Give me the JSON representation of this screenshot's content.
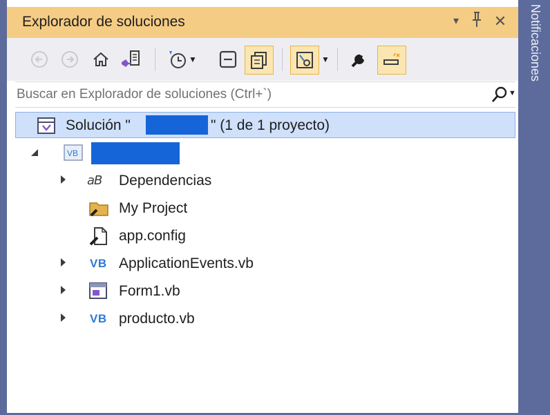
{
  "window": {
    "title": "Explorador de soluciones",
    "title_buttons": [
      "▾",
      "ᵢ",
      "✕"
    ]
  },
  "toolbar": {
    "items": [
      "back-icon",
      "forward-icon",
      "home-icon",
      "switch-views-icon",
      "pending-changes-filter-icon",
      "collapse-all-icon",
      "show-all-files-icon",
      "preview-selected-icon",
      "properties-icon",
      "sync-active-document-icon"
    ]
  },
  "search": {
    "placeholder": "Buscar en Explorador de soluciones (Ctrl+`)"
  },
  "solution": {
    "prefix": "Solución \"",
    "suffix": "\" (1 de 1 proyecto)"
  },
  "tree": {
    "items": [
      {
        "label": "Dependencias",
        "icon": "dependencies-icon"
      },
      {
        "label": "My Project",
        "icon": "my-project-icon"
      },
      {
        "label": "app.config",
        "icon": "config-file-icon"
      },
      {
        "label": "ApplicationEvents.vb",
        "icon": "vb-file-icon"
      },
      {
        "label": "Form1.vb",
        "icon": "form-file-icon"
      },
      {
        "label": "producto.vb",
        "icon": "vb-file-icon"
      }
    ],
    "vb_label": "VB",
    "project_icon_label": "VB"
  },
  "notifications": {
    "label": "Notificaciones"
  },
  "colors": {
    "title_bar": "#f5cc84",
    "selection": "#cfe0fb",
    "redaction": "#1565d8",
    "side_strip": "#5c6b9c"
  }
}
